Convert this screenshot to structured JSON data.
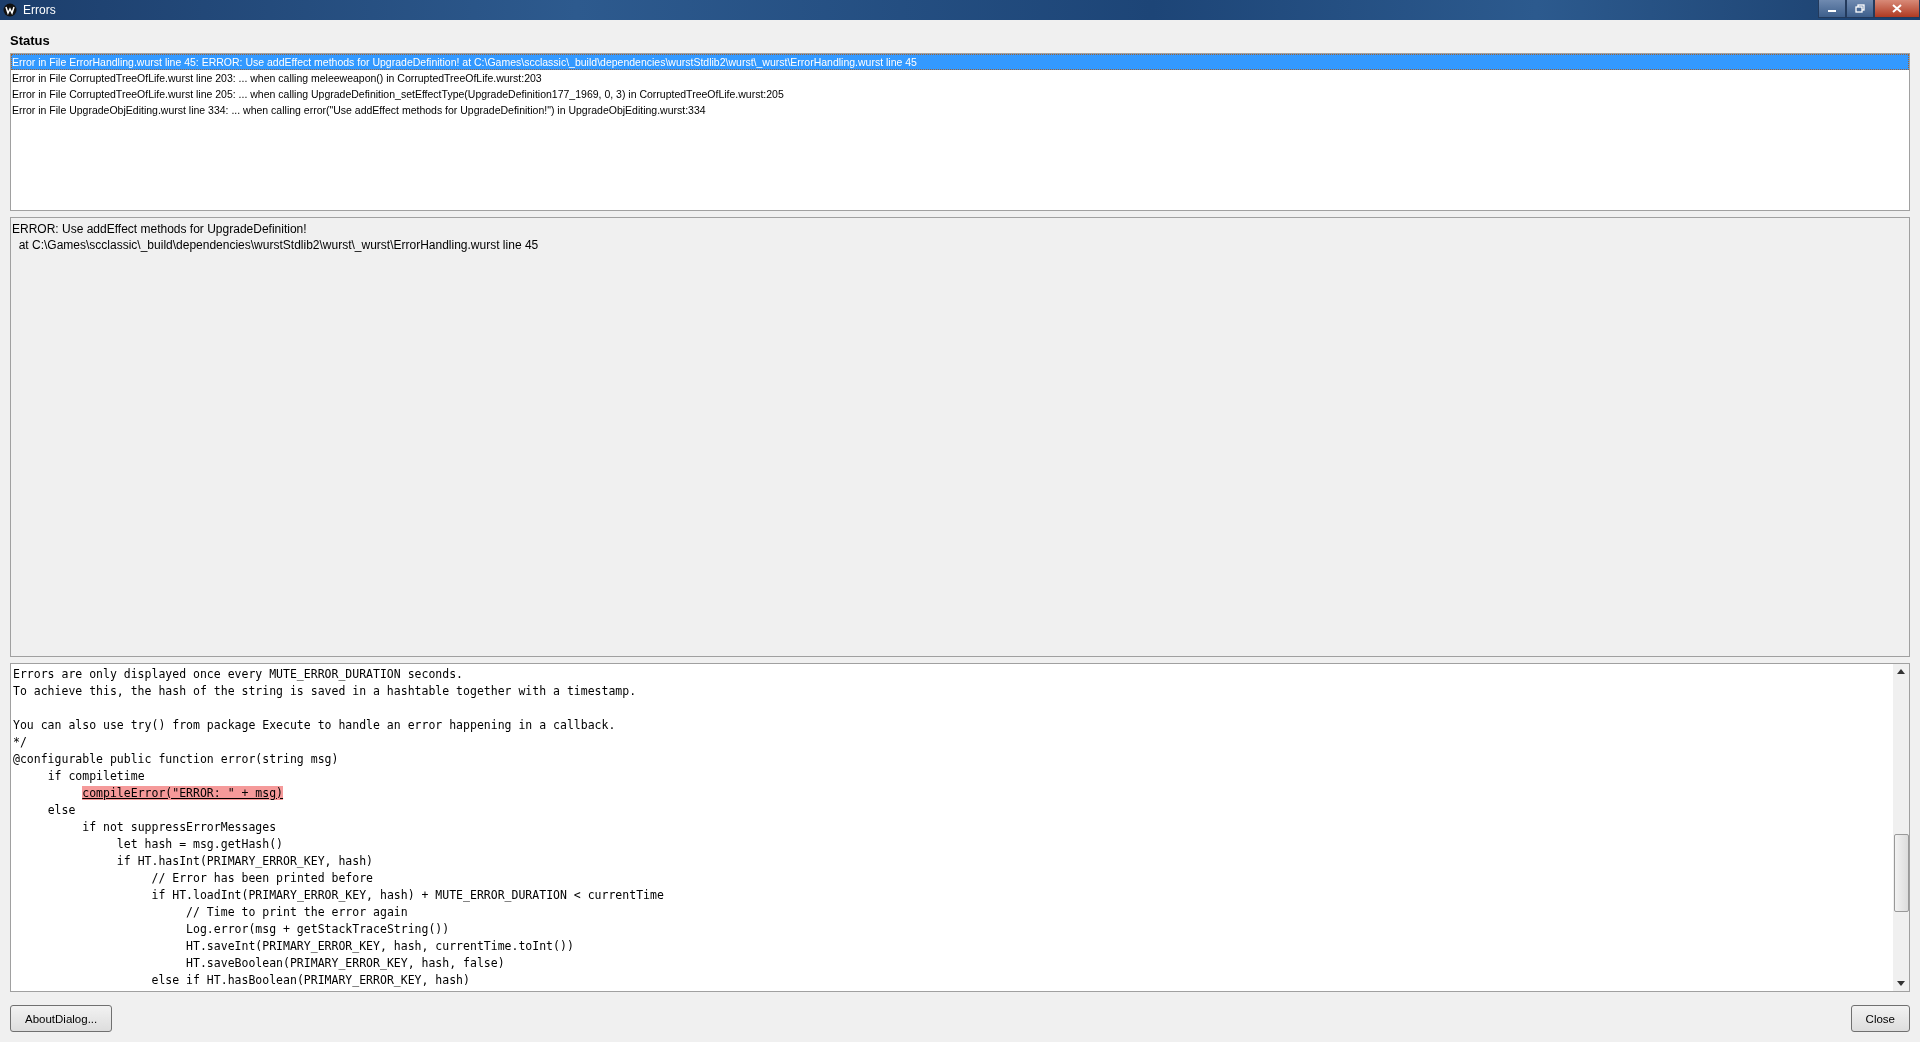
{
  "window": {
    "title": "Errors"
  },
  "status": {
    "label": "Status",
    "errors": [
      {
        "text": "Error in File ErrorHandling.wurst line 45: ERROR: Use addEffect methods for UpgradeDefinition!  at C:\\Games\\scclassic\\_build\\dependencies\\wurstStdlib2\\wurst\\_wurst\\ErrorHandling.wurst line 45",
        "selected": true
      },
      {
        "text": "Error in File CorruptedTreeOfLife.wurst line 203: ... when calling meleeweapon() in CorruptedTreeOfLife.wurst:203",
        "selected": false
      },
      {
        "text": "Error in File CorruptedTreeOfLife.wurst line 205: ... when calling UpgradeDefinition_setEffectType(UpgradeDefinition177_1969, 0, 3) in CorruptedTreeOfLife.wurst:205",
        "selected": false
      },
      {
        "text": "Error in File UpgradeObjEditing.wurst line 334: ... when calling error(\"Use addEffect methods for UpgradeDefinition!\") in UpgradeObjEditing.wurst:334",
        "selected": false
      }
    ]
  },
  "details": [
    "ERROR: Use addEffect methods for UpgradeDefinition!",
    "  at C:\\Games\\scclassic\\_build\\dependencies\\wurstStdlib2\\wurst\\_wurst\\ErrorHandling.wurst line 45"
  ],
  "code": [
    {
      "text": "Errors are only displayed once every MUTE_ERROR_DURATION seconds.",
      "highlighted": false
    },
    {
      "text": "To achieve this, the hash of the string is saved in a hashtable together with a timestamp.",
      "highlighted": false
    },
    {
      "text": "You can also use try() from package Execute to handle an error happening in a callback.",
      "highlighted": false,
      "gap_before": true
    },
    {
      "text": "*/",
      "highlighted": false
    },
    {
      "text": "@configurable public function error(string msg)",
      "highlighted": false
    },
    {
      "text": "     if compiletime",
      "highlighted": false
    },
    {
      "text": "          compileError(\"ERROR: \" + msg)",
      "highlighted": true
    },
    {
      "text": "     else",
      "highlighted": false
    },
    {
      "text": "          if not suppressErrorMessages",
      "highlighted": false
    },
    {
      "text": "               let hash = msg.getHash()",
      "highlighted": false
    },
    {
      "text": "               if HT.hasInt(PRIMARY_ERROR_KEY, hash)",
      "highlighted": false
    },
    {
      "text": "                    // Error has been printed before",
      "highlighted": false
    },
    {
      "text": "                    if HT.loadInt(PRIMARY_ERROR_KEY, hash) + MUTE_ERROR_DURATION < currentTime",
      "highlighted": false
    },
    {
      "text": "                         // Time to print the error again",
      "highlighted": false
    },
    {
      "text": "                         Log.error(msg + getStackTraceString())",
      "highlighted": false
    },
    {
      "text": "                         HT.saveInt(PRIMARY_ERROR_KEY, hash, currentTime.toInt())",
      "highlighted": false
    },
    {
      "text": "                         HT.saveBoolean(PRIMARY_ERROR_KEY, hash, false)",
      "highlighted": false
    },
    {
      "text": "                    else if HT.hasBoolean(PRIMARY_ERROR_KEY, hash)",
      "highlighted": false
    }
  ],
  "buttons": [
    {
      "label": "AboutDialog...",
      "kind": "left"
    },
    {
      "label": "Close",
      "kind": "right"
    }
  ]
}
